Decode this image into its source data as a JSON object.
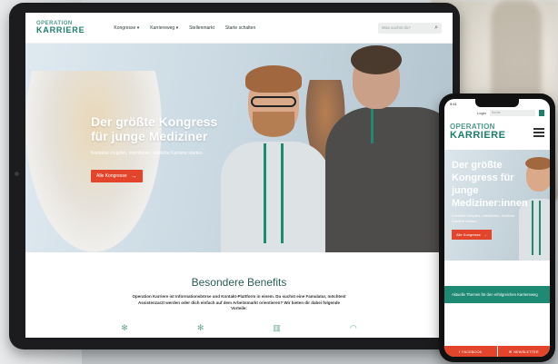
{
  "tablet": {
    "logo_top": "OPERATION",
    "logo_bottom": "KARRIERE",
    "menu": [
      "Kongresse ▾",
      "Karriereweg ▾",
      "Stellenmarkt",
      "Starte schalten"
    ],
    "search_placeholder": "Was suchst du?",
    "hero": {
      "title": "Der größte Kongress für junge Mediziner",
      "subtitle": "Kontakte knüpfen, orientieren, ärztliche Karriere starten.",
      "button_label": "Alle Kongresse",
      "button_arrow": "→"
    },
    "benefits": {
      "title": "Besondere Benefits",
      "text": "Operation Karriere ist Informationsbörse und Kontakt-Plattform in einem. Du suchst eine Famulatur, möchtest Assistenzarzt werden oder dich einfach auf dem Arbeitsmarkt orientieren? Wir bieten dir dabei folgende Vorteile:"
    }
  },
  "phone": {
    "time": "9:41",
    "login": "Login",
    "search_placeholder": "Suche",
    "logo_top": "OPERATION",
    "logo_bottom": "KARRIERE",
    "hero": {
      "title": "Der größte Kongress für junge Mediziner:innen",
      "subtitle": "Kontakte knüpfen, orientieren, ärztliche Karriere starten.",
      "button_label": "Alle Kongresse",
      "button_arrow": "→"
    },
    "topics_text": "Aktuelle Themen für den erfolgreichen Karriereweg",
    "bottom": {
      "left": "FACEBOOK",
      "right": "NEWSLETTER"
    }
  }
}
